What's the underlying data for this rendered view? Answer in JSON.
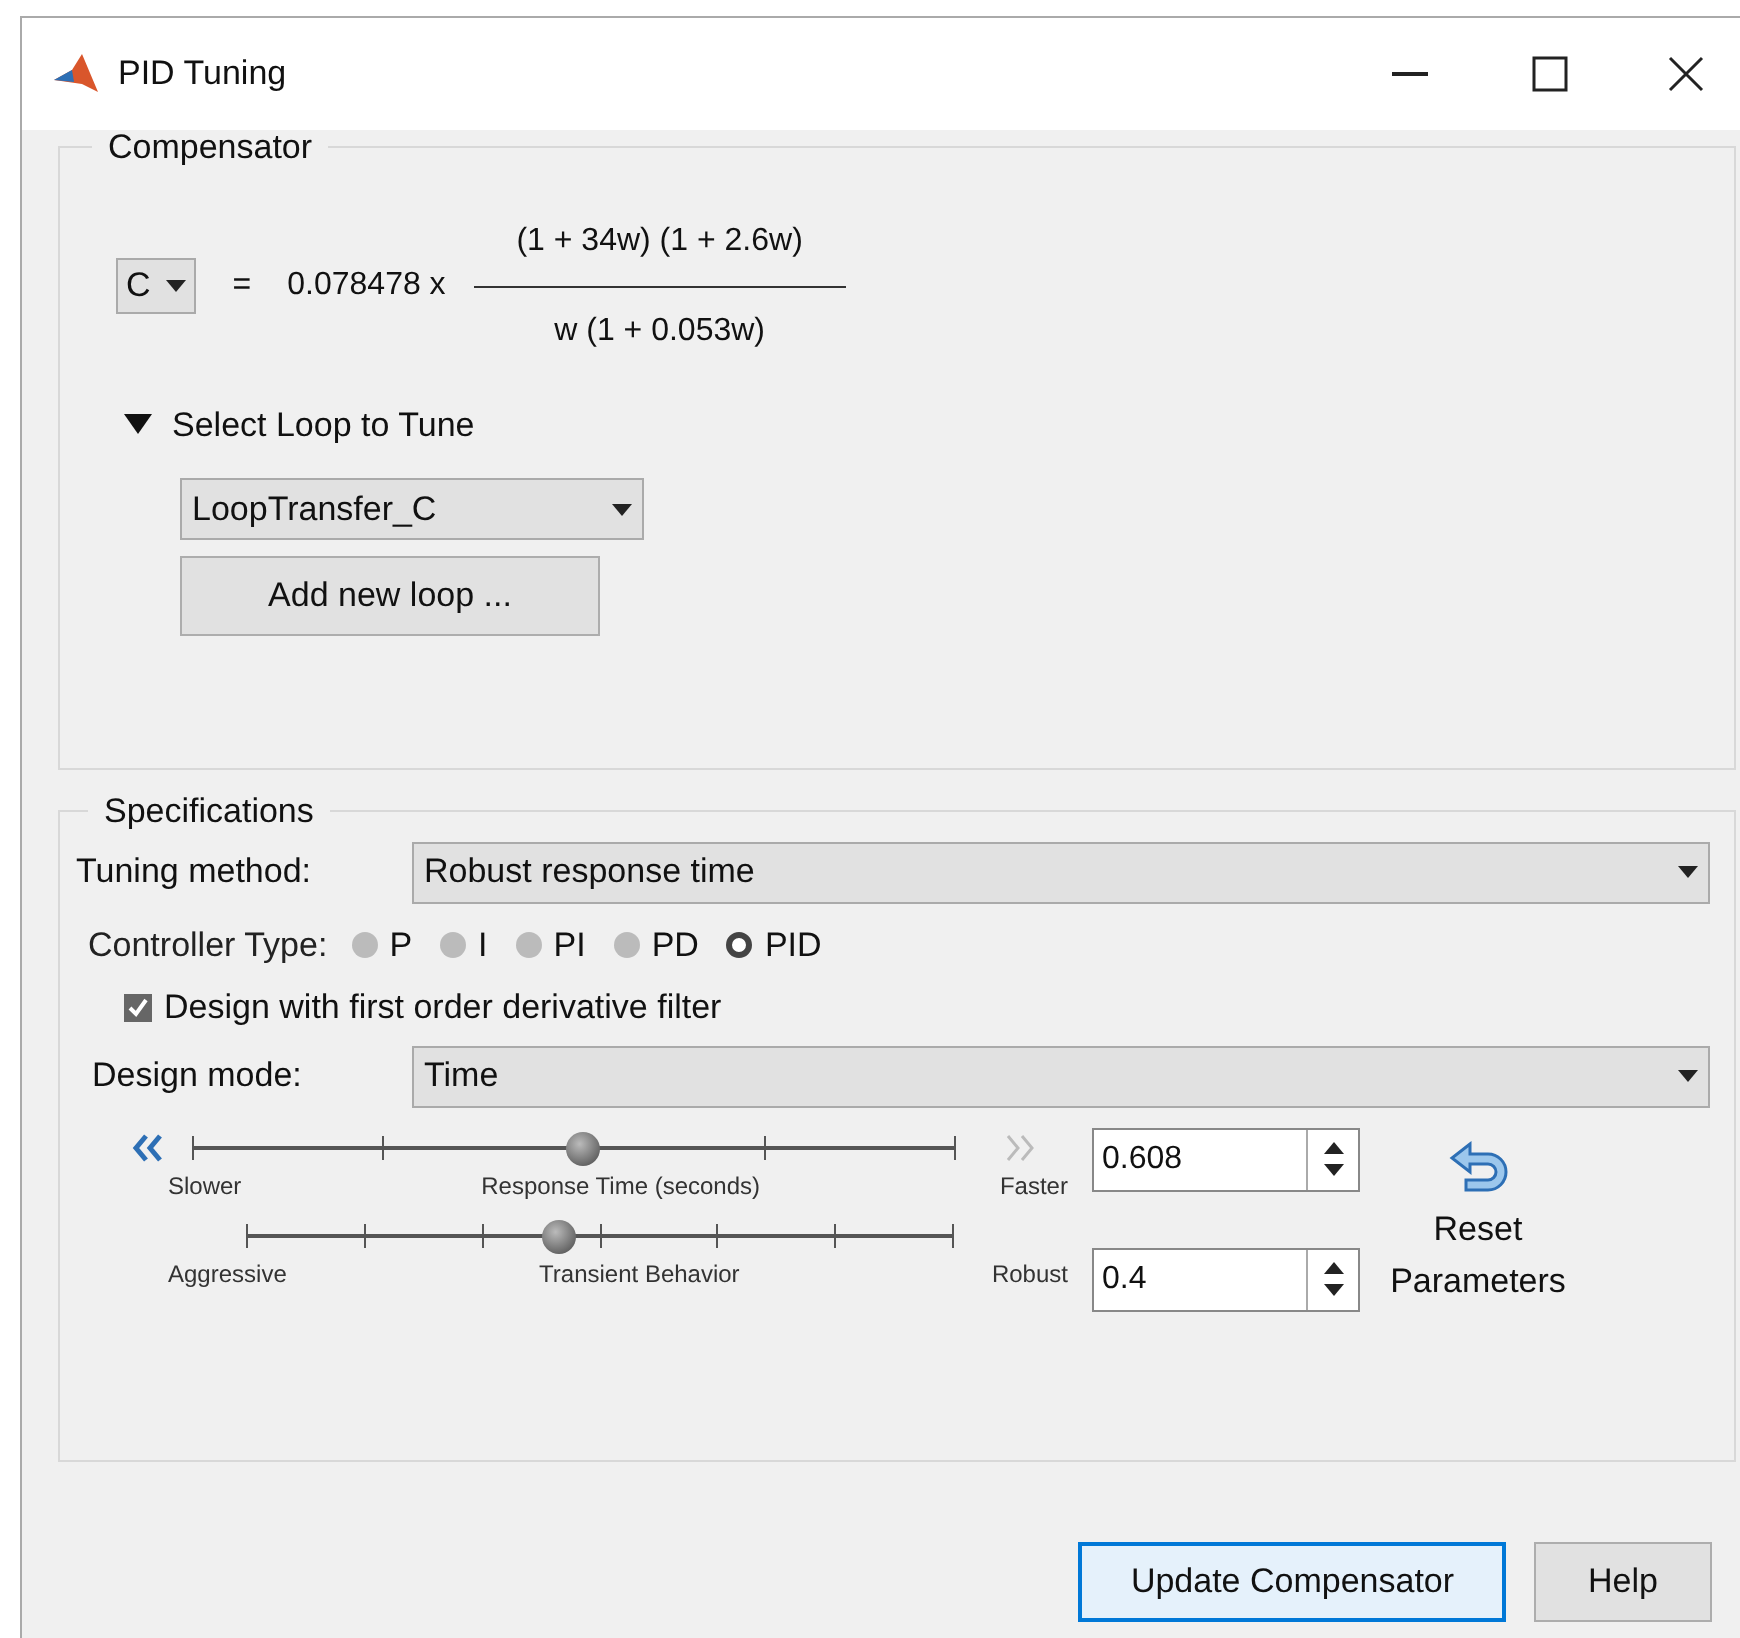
{
  "window": {
    "title": "PID Tuning"
  },
  "compensator": {
    "title": "Compensator",
    "variable": "C",
    "equals": "=",
    "gain": "0.078478 x",
    "numerator": "(1 + 34w) (1 + 2.6w)",
    "denominator": "w (1 + 0.053w)",
    "loop_section": {
      "title": "Select Loop to Tune",
      "expanded": true,
      "loop": "LoopTransfer_C",
      "add_button": "Add new loop ..."
    }
  },
  "specifications": {
    "title": "Specifications",
    "tuning_method_label": "Tuning method:",
    "tuning_method": "Robust response time",
    "controller_type_label": "Controller Type:",
    "controller_types": [
      {
        "label": "P",
        "selected": false
      },
      {
        "label": "I",
        "selected": false
      },
      {
        "label": "PI",
        "selected": false
      },
      {
        "label": "PD",
        "selected": false
      },
      {
        "label": "PID",
        "selected": true
      }
    ],
    "derivative_filter": {
      "label": "Design with first order derivative filter",
      "checked": true
    },
    "design_mode_label": "Design mode:",
    "design_mode": "Time",
    "sliders": [
      {
        "left": "Slower",
        "center": "Response Time (seconds)",
        "right": "Faster",
        "level": 0.51,
        "value": "0.608"
      },
      {
        "left": "Aggressive",
        "center": "Transient Behavior",
        "right": "Robust",
        "level": 0.44,
        "value": "0.4"
      }
    ],
    "reset_button": "Reset Parameters"
  },
  "buttons": [
    "Update Compensator",
    "Help"
  ]
}
